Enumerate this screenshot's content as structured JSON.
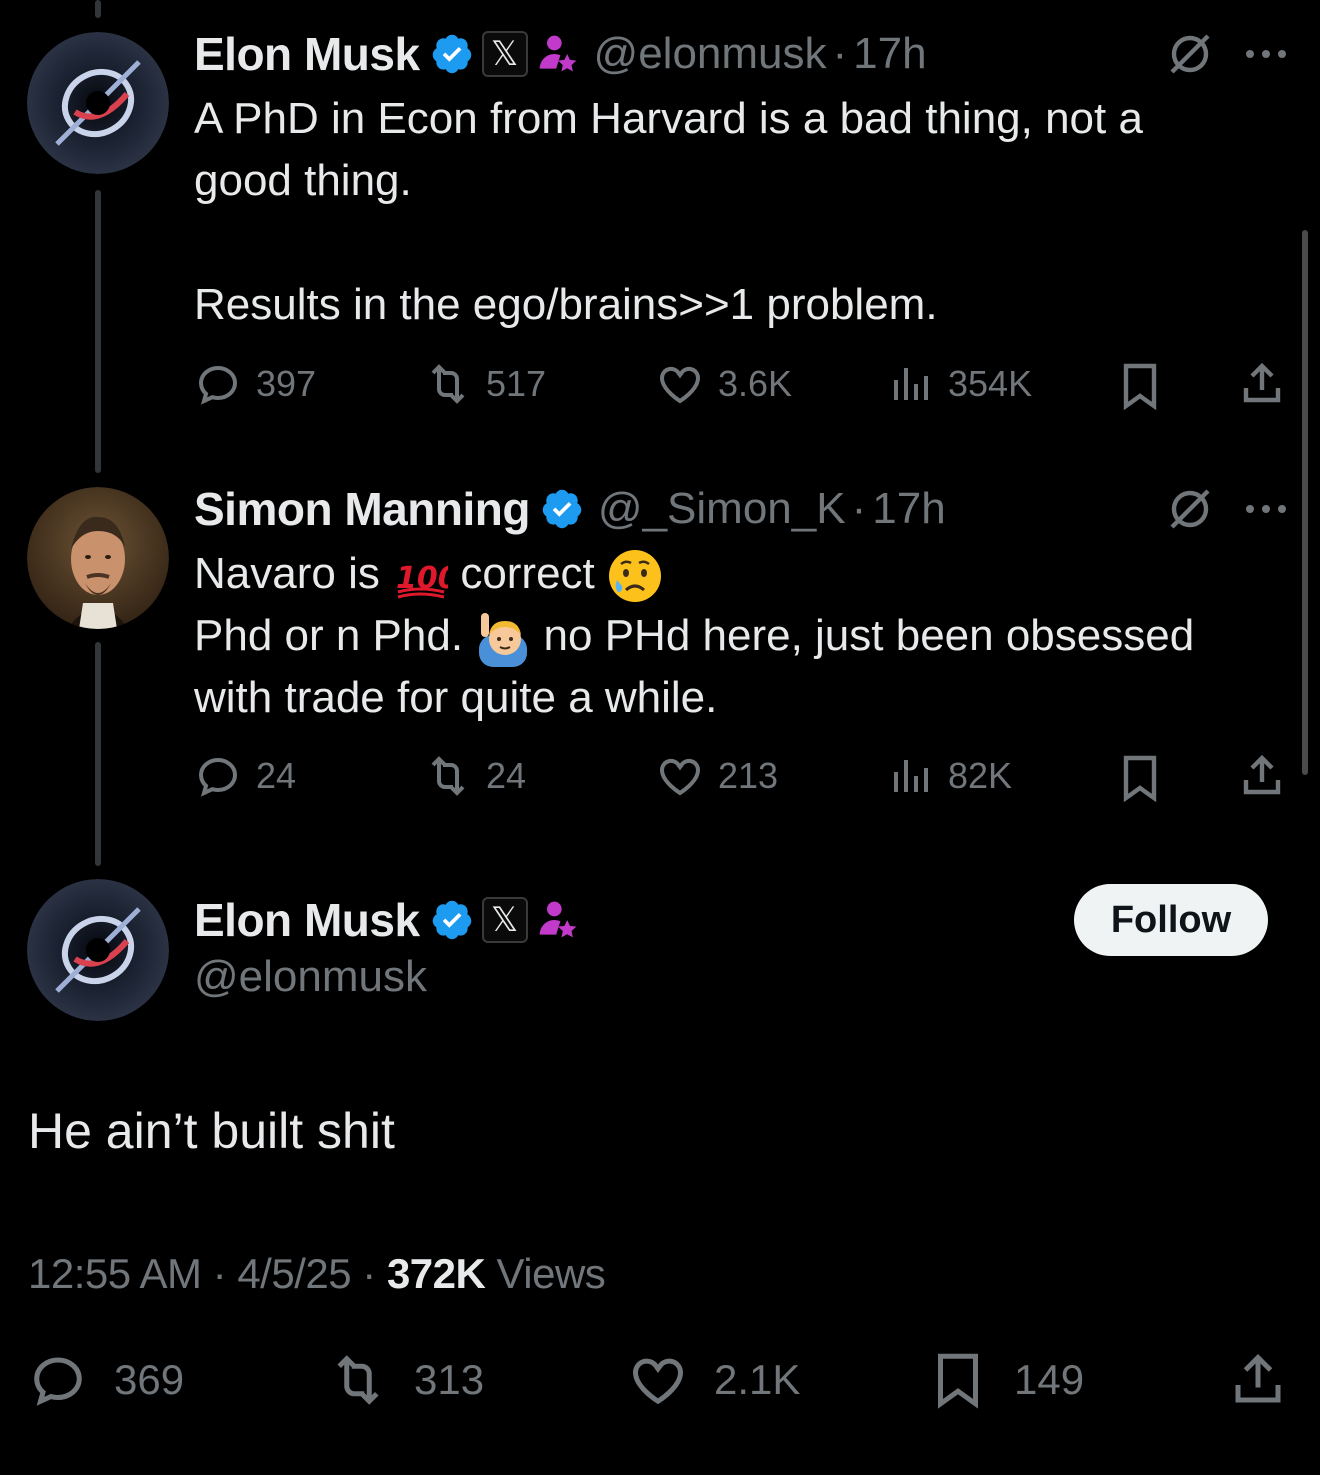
{
  "tweets": [
    {
      "author": "Elon Musk",
      "handle": "@elonmusk",
      "separator": "·",
      "time": "17h",
      "text_line1": "A PhD in Econ from Harvard is a bad thing, not a",
      "text_line2": "good thing.",
      "text_line3": "Results in the ego/brains>>1 problem.",
      "replies": "397",
      "reposts": "517",
      "likes": "3.6K",
      "views": "354K"
    },
    {
      "author": "Simon Manning",
      "handle": "@_Simon_K",
      "separator": "·",
      "time": "17h",
      "text_line1_a": "Navaro is ",
      "text_line1_b": " correct ",
      "text_line2_a": "Phd or n Phd. ",
      "text_line2_b": " no PHd here, just been obsessed",
      "text_line3": "with trade for quite a while.",
      "replies": "24",
      "reposts": "24",
      "likes": "213",
      "views": "82K"
    }
  ],
  "main_tweet": {
    "author": "Elon Musk",
    "handle": "@elonmusk",
    "follow_label": "Follow",
    "text": "He ain’t built shit",
    "time": "12:55 AM",
    "date": "4/5/25",
    "separator": "·",
    "views_count": "372K",
    "views_label": "Views",
    "replies": "369",
    "reposts": "313",
    "likes": "2.1K",
    "bookmarks": "149"
  },
  "colors": {
    "background": "#000000",
    "text": "#e7e9ea",
    "muted": "#71767b",
    "verified": "#1d9bf0",
    "affiliate": "#c13ac9"
  }
}
